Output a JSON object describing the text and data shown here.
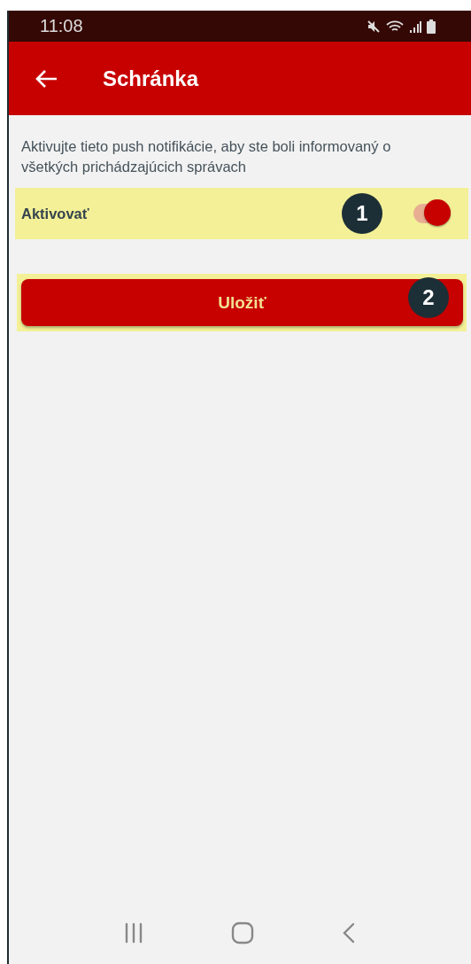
{
  "status_bar": {
    "time": "11:08"
  },
  "app_bar": {
    "title": "Schránka"
  },
  "description": "Aktivujte tieto push notifikácie, aby ste boli informovaný o všetkých prichádzajúcich správach",
  "setting": {
    "label": "Aktivovať",
    "on": true,
    "highlighted": true,
    "marker": "1"
  },
  "save_button": {
    "label": "Uložiť",
    "highlighted": true,
    "marker": "2"
  }
}
